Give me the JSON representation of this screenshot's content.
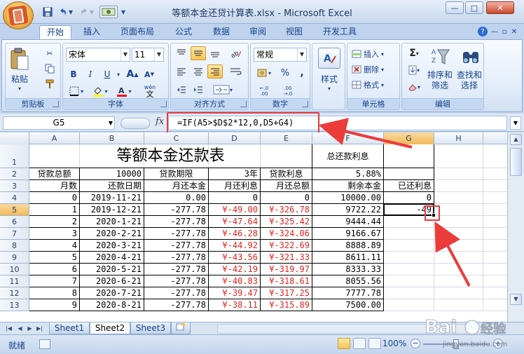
{
  "window": {
    "title": "等额本金还贷计算表.xlsx - Microsoft Excel",
    "minimize": "—",
    "maximize": "□",
    "close": "✕"
  },
  "ribbon": {
    "tabs": [
      "开始",
      "插入",
      "页面布局",
      "公式",
      "数据",
      "审阅",
      "视图",
      "开发工具"
    ],
    "active_tab": "开始",
    "groups": {
      "clipboard": {
        "label": "剪贴板",
        "paste": "粘贴"
      },
      "font": {
        "label": "字体",
        "font_name": "宋体",
        "font_size": "11",
        "bold": "B",
        "italic": "I",
        "underline": "U",
        "grow": "A",
        "shrink": "A",
        "wen": "wén"
      },
      "alignment": {
        "label": "对齐方式"
      },
      "number": {
        "label": "数字",
        "format": "常规",
        "percent": "%",
        "comma": ",",
        "inc": "+.0 .00",
        "dec": ".00 →.0"
      },
      "styles": {
        "label": "样式"
      },
      "cells": {
        "label": "单元格",
        "insert": "插入",
        "delete": "删除",
        "format": "格式"
      },
      "editing": {
        "label": "编辑",
        "sigma": "Σ",
        "sort_filter": "排序和\n筛选",
        "find_select": "查找和\n选择"
      }
    }
  },
  "formula_bar": {
    "name_box": "G5",
    "fx": "fx",
    "formula": "=IF(A5>$D$2*12,0,D5+G4)"
  },
  "sheet": {
    "columns": [
      "A",
      "B",
      "C",
      "D",
      "E",
      "F",
      "G",
      "H"
    ],
    "selected_column": "G",
    "rows": [
      "1",
      "2",
      "3",
      "4",
      "5",
      "6",
      "7",
      "8",
      "9",
      "10",
      "11",
      "12",
      "13"
    ],
    "selected_row": "5",
    "title": "等额本金还款表",
    "total_interest_label": "总还款利息",
    "row2": [
      "贷款总额",
      "10000",
      "贷款期限",
      "3年",
      "贷款利息",
      "5.88%"
    ],
    "headers": [
      "月数",
      "还款日期",
      "月还本金",
      "月还利息",
      "月还总额",
      "剩余本金",
      "已还利息"
    ],
    "data": [
      [
        "0",
        "2019-11-21",
        "0.00",
        "0",
        "0",
        "10000.00",
        "0"
      ],
      [
        "1",
        "2019-12-21",
        "-277.78",
        "¥-49.00",
        "¥-326.78",
        "9722.22",
        "-49"
      ],
      [
        "2",
        "2020-1-21",
        "-277.78",
        "¥-47.64",
        "¥-325.42",
        "9444.44",
        ""
      ],
      [
        "3",
        "2020-2-21",
        "-277.78",
        "¥-46.28",
        "¥-324.06",
        "9166.67",
        ""
      ],
      [
        "4",
        "2020-3-21",
        "-277.78",
        "¥-44.92",
        "¥-322.69",
        "8888.89",
        ""
      ],
      [
        "5",
        "2020-4-21",
        "-277.78",
        "¥-43.56",
        "¥-321.33",
        "8611.11",
        ""
      ],
      [
        "6",
        "2020-5-21",
        "-277.78",
        "¥-42.19",
        "¥-319.97",
        "8333.33",
        ""
      ],
      [
        "7",
        "2020-6-21",
        "-277.78",
        "¥-40.83",
        "¥-318.61",
        "8055.56",
        ""
      ],
      [
        "8",
        "2020-7-21",
        "-277.78",
        "¥-39.47",
        "¥-317.25",
        "7777.78",
        ""
      ],
      [
        "9",
        "2020-8-21",
        "-277.78",
        "¥-38.11",
        "¥-315.89",
        "7500.00",
        ""
      ]
    ]
  },
  "sheet_tabs": [
    "Sheet1",
    "Sheet2",
    "Sheet3"
  ],
  "active_sheet": "Sheet2",
  "status": {
    "ready": "就绪",
    "zoom": "100%",
    "zoom_minus": "−",
    "zoom_plus": "+"
  },
  "watermark": {
    "text": "jingyan.baidu.com"
  },
  "colors": {
    "accent_red": "#ec3b3b",
    "negative_red": "#e8231f",
    "ribbon_blue": "#15428b",
    "selection_orange": "#f1ba5b"
  }
}
